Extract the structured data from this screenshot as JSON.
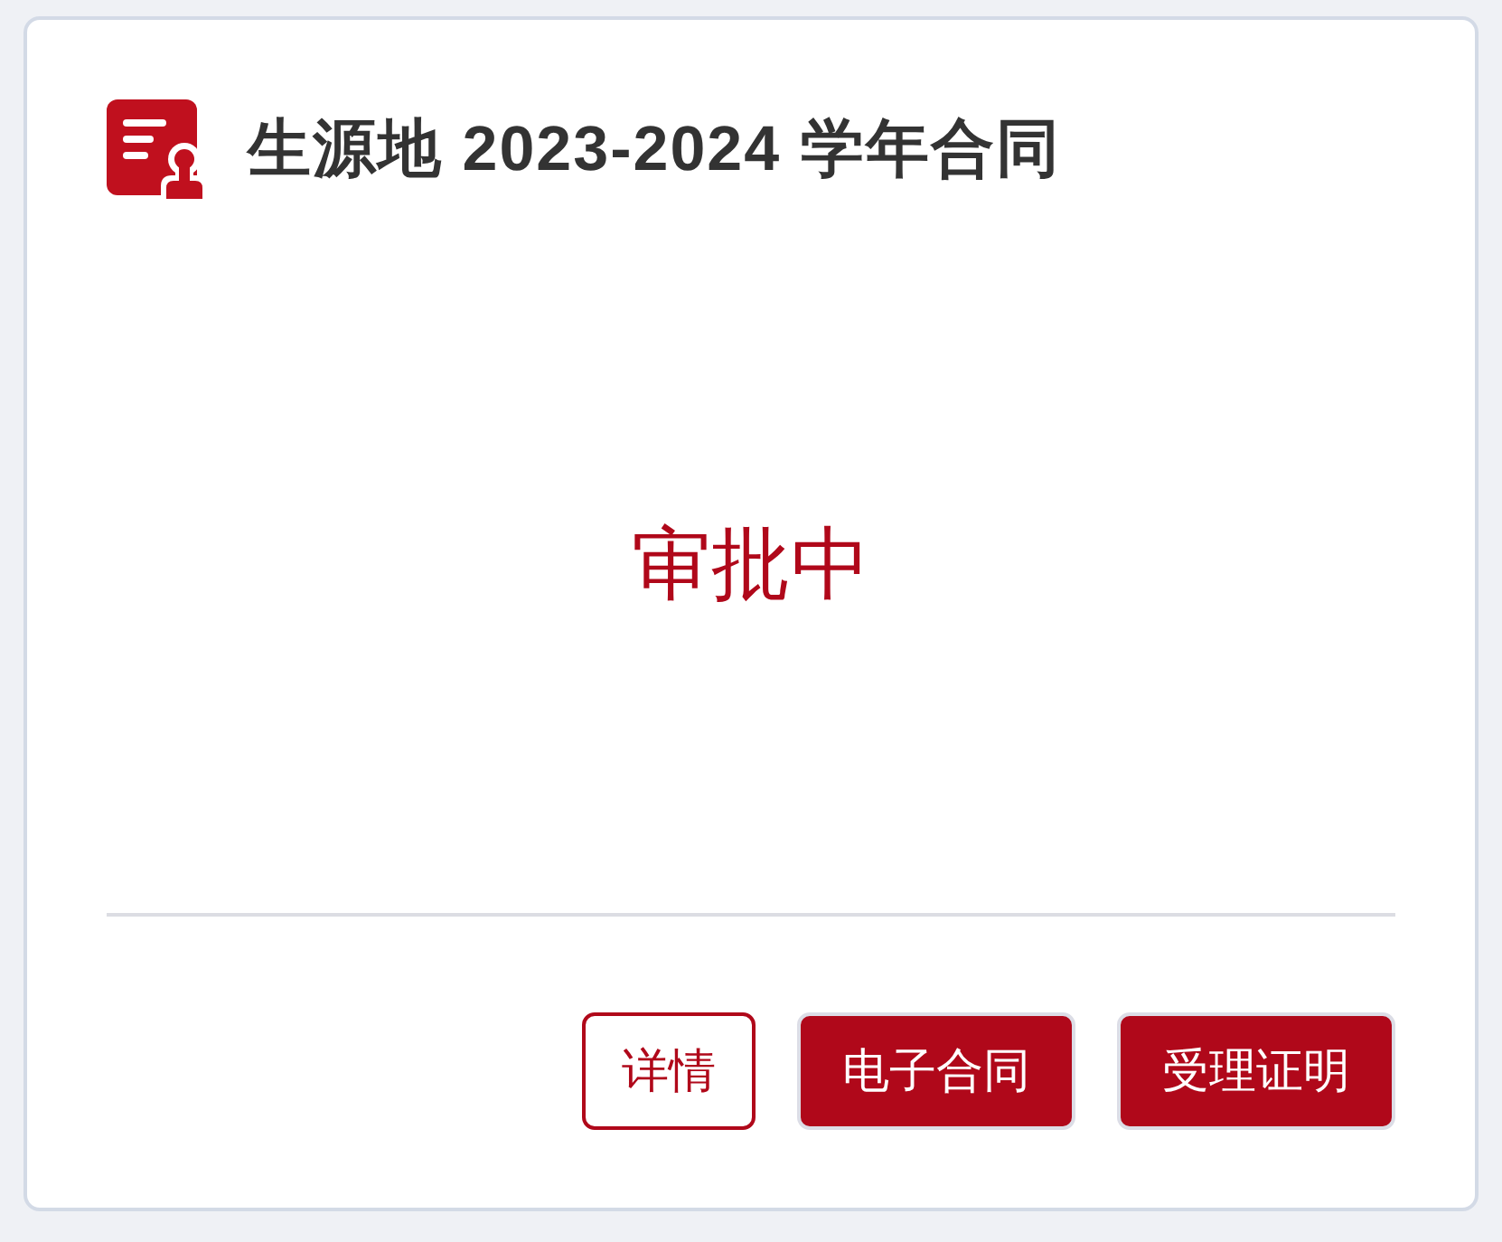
{
  "card": {
    "title": "生源地 2023-2024 学年合同",
    "status": "审批中"
  },
  "buttons": [
    {
      "label": "详情",
      "kind": "outline"
    },
    {
      "label": "电子合同",
      "kind": "filled"
    },
    {
      "label": "受理证明",
      "kind": "filled"
    }
  ]
}
